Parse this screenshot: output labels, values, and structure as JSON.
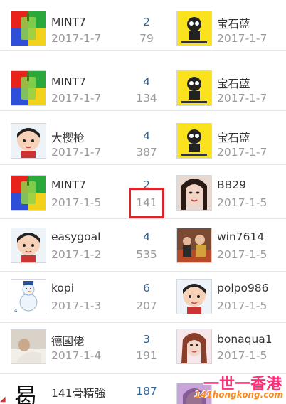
{
  "threads": [
    {
      "author": "MINT7",
      "author_date": "2017-1-7",
      "replies": "2",
      "views": "79",
      "last_poster": "宝石蓝",
      "last_date": "2017-1-7",
      "author_avatar": "drink-avatar",
      "last_avatar": "cartoon-avatar"
    },
    {
      "author": "MINT7",
      "author_date": "2017-1-7",
      "replies": "4",
      "views": "134",
      "last_poster": "宝石蓝",
      "last_date": "2017-1-7",
      "author_avatar": "drink-avatar",
      "last_avatar": "cartoon-avatar"
    },
    {
      "author": "大樱枪",
      "author_date": "2017-1-7",
      "replies": "4",
      "views": "387",
      "last_poster": "宝石蓝",
      "last_date": "2017-1-7",
      "author_avatar": "default-avatar",
      "last_avatar": "cartoon-avatar"
    },
    {
      "author": "MINT7",
      "author_date": "2017-1-5",
      "replies": "2",
      "views": "141",
      "last_poster": "BB29",
      "last_date": "2017-1-5",
      "author_avatar": "drink-avatar",
      "last_avatar": "portrait-avatar"
    },
    {
      "author": "easygoal",
      "author_date": "2017-1-2",
      "replies": "4",
      "views": "535",
      "last_poster": "win7614",
      "last_date": "2017-1-5",
      "author_avatar": "default-avatar",
      "last_avatar": "group-photo-avatar"
    },
    {
      "author": "kopi",
      "author_date": "2017-1-3",
      "replies": "6",
      "views": "207",
      "last_poster": "polpo986",
      "last_date": "2017-1-5",
      "author_avatar": "snowman-avatar",
      "last_avatar": "default-avatar"
    },
    {
      "author": "德國佬",
      "author_date": "2017-1-4",
      "replies": "3",
      "views": "191",
      "last_poster": "bonaqua1",
      "last_date": "2017-1-5",
      "author_avatar": "photo-avatar",
      "last_avatar": "portrait-avatar"
    },
    {
      "author": "141骨精強",
      "author_date": "",
      "replies": "187",
      "views": "",
      "last_poster": "",
      "last_date": "",
      "author_avatar": "calligraphy-avatar",
      "last_avatar": "portrait-avatar"
    }
  ],
  "highlight_color": "#d9262c",
  "watermark": {
    "title": "一世一香港",
    "url": "141hongkong.com"
  },
  "partial_glyph": "曷",
  "colors": {
    "reply_count": "#336699",
    "meta_text": "#9a9a9a",
    "name_text": "#333333",
    "row_border": "#e3e8ee"
  }
}
